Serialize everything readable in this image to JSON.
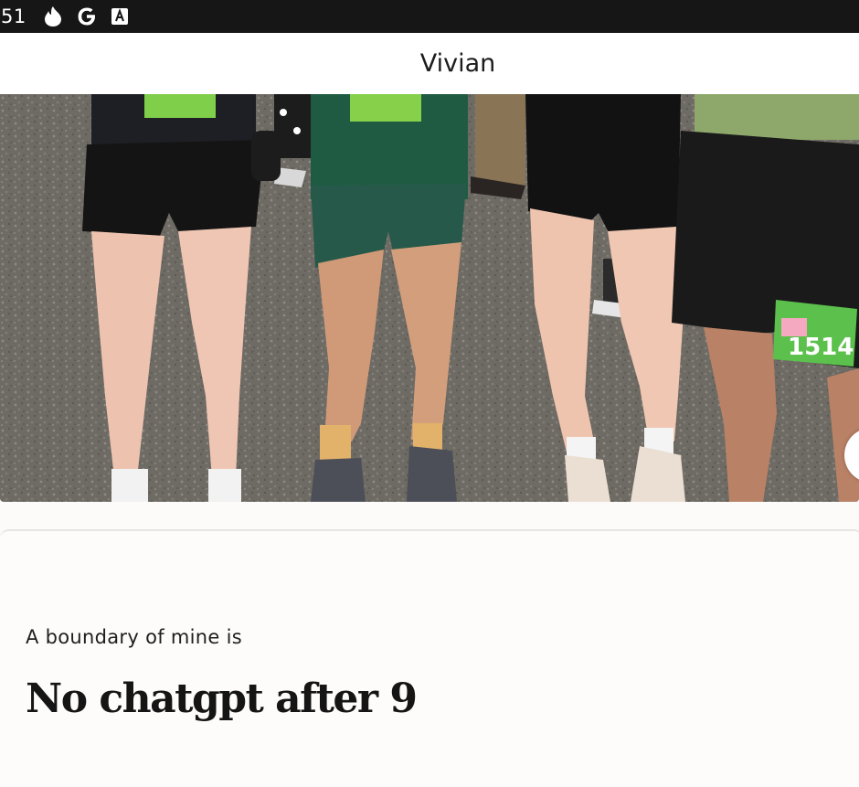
{
  "status_bar": {
    "time": "51",
    "icons": [
      "flame-icon",
      "google-icon",
      "font-a-icon"
    ]
  },
  "header": {
    "title": "Vivian"
  },
  "photo": {
    "description_icon": "runners-photo",
    "bib_number": "1514"
  },
  "prompt": {
    "label": "A boundary of mine is",
    "answer": "No chatgpt after 9"
  },
  "colors": {
    "status_bar_bg": "#161616",
    "page_bg": "#fcfbf9",
    "text": "#1c1c1c"
  }
}
